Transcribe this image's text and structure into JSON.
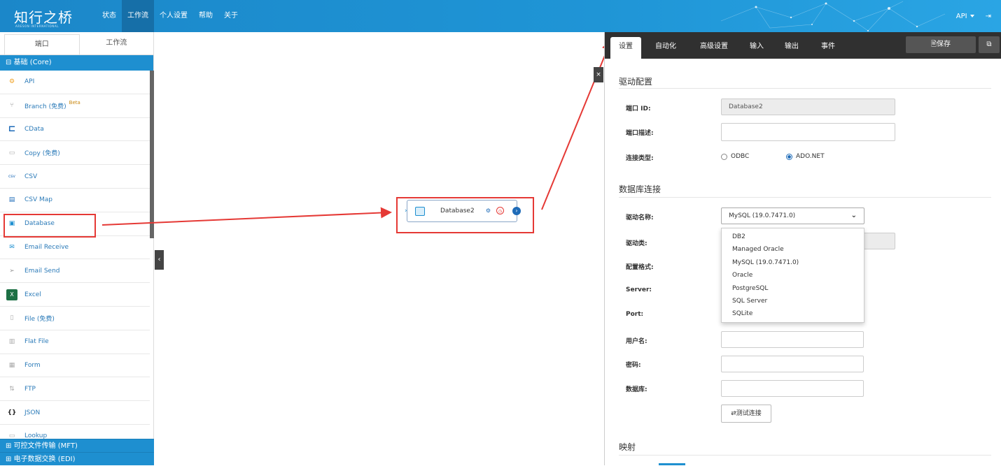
{
  "app": {
    "logo_text": "知行之桥",
    "logo_sub": "ARESON INTERNATIONAL"
  },
  "nav": {
    "items": [
      "状态",
      "工作流",
      "个人设置",
      "帮助",
      "关于"
    ],
    "active_index": 1
  },
  "top_right": {
    "api_label": "API",
    "logout_icon": "logout-icon"
  },
  "left_panel": {
    "tabs": [
      "端口",
      "工作流"
    ],
    "active_tab": 0,
    "group_title": "⊟ 基础 (Core)",
    "items": [
      {
        "label": "API",
        "icon": "api-icon"
      },
      {
        "label": "Branch (免费)",
        "icon": "branch-icon",
        "badge": "Beta"
      },
      {
        "label": "CData",
        "icon": "cdata-icon"
      },
      {
        "label": "Copy (免费)",
        "icon": "copy-icon"
      },
      {
        "label": "CSV",
        "icon": "csv-icon"
      },
      {
        "label": "CSV Map",
        "icon": "csv-map-icon"
      },
      {
        "label": "Database",
        "icon": "database-icon"
      },
      {
        "label": "Email Receive",
        "icon": "email-receive-icon"
      },
      {
        "label": "Email Send",
        "icon": "email-send-icon"
      },
      {
        "label": "Excel",
        "icon": "excel-icon"
      },
      {
        "label": "File (免费)",
        "icon": "file-icon"
      },
      {
        "label": "Flat File",
        "icon": "flat-file-icon"
      },
      {
        "label": "Form",
        "icon": "form-icon"
      },
      {
        "label": "FTP",
        "icon": "ftp-icon"
      },
      {
        "label": "JSON",
        "icon": "json-icon"
      },
      {
        "label": "Lookup",
        "icon": "lookup-icon"
      }
    ],
    "footer_groups": [
      "⊞ 可控文件传输 (MFT)",
      "⊞ 电子数据交换 (EDI)"
    ]
  },
  "canvas": {
    "node_label": "Database2"
  },
  "right_panel": {
    "tabs": [
      "设置",
      "自动化",
      "高级设置",
      "输入",
      "输出",
      "事件"
    ],
    "active_tab": 0,
    "save_label": "🖹保存",
    "section_driver": "驱动配置",
    "port_id_label": "端口 ID:",
    "port_id_value": "Database2",
    "port_desc_label": "端口描述:",
    "conn_type_label": "连接类型:",
    "conn_options": [
      "ODBC",
      "ADO.NET"
    ],
    "conn_selected": "ADO.NET",
    "section_db": "数据库连接",
    "driver_name_label": "驱动名称:",
    "driver_name_value": "MySQL (19.0.7471.0)",
    "driver_class_label": "驱动类:",
    "config_format_label": "配置格式:",
    "server_label": "Server:",
    "port_label": "Port:",
    "user_label": "用户名:",
    "password_label": "密码:",
    "database_label": "数据库:",
    "driver_options": [
      "DB2",
      "Managed Oracle",
      "MySQL (19.0.7471.0)",
      "Oracle",
      "PostgreSQL",
      "SQL Server",
      "SQLite"
    ],
    "test_button": "⇄测试连接",
    "section_mapping": "映射"
  },
  "colors": {
    "topbar": "#1f95d6",
    "accent": "#1e8fd0",
    "highlight": "#e53935",
    "tabbar": "#303030"
  }
}
